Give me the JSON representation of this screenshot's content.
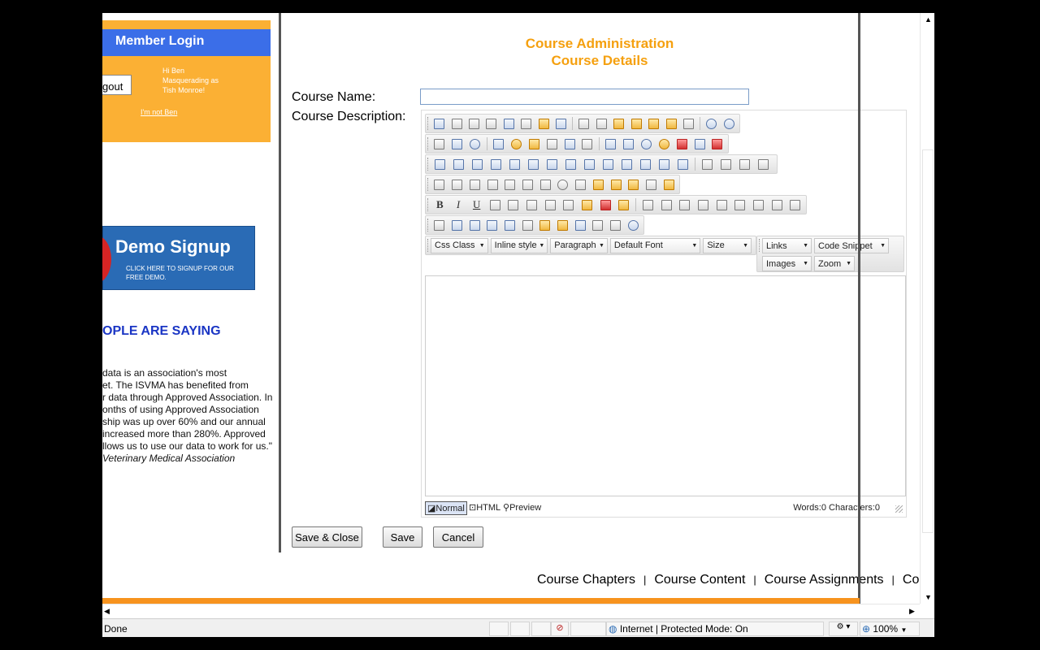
{
  "sidebar": {
    "login_title": "Member Login",
    "logout_label": "gout",
    "greeting": "Hi Ben",
    "masquerade_line1": "Masquerading as",
    "masquerade_line2": "Tish Monroe!",
    "not_ben_link": "I'm not Ben",
    "demo_title": "Demo Signup",
    "demo_subtitle_line1": "CLICK HERE TO SIGNUP FOR OUR",
    "demo_subtitle_line2": "FREE DEMO.",
    "saying_title": "OPLE ARE SAYING",
    "quote_lines": [
      "data is an association's most",
      "et. The ISVMA has benefited from",
      "r data through Approved Association. In",
      "onths of using Approved Association",
      "ship was up over 60% and our annual",
      "increased more than 280%. Approved",
      "llows us to use our data to work for us.\""
    ],
    "quote_source": "Veterinary Medical Association"
  },
  "page": {
    "title": "Course Administration",
    "subtitle": "Course Details",
    "course_name_label": "Course Name:",
    "course_name_value": "",
    "course_desc_label": "Course Description:"
  },
  "editor": {
    "dropdowns_row1": [
      "Css Class",
      "Inline style",
      "Paragraph",
      "Default Font",
      "Size"
    ],
    "dropdowns_right_row1": [
      "Links",
      "Code Snippet"
    ],
    "dropdowns_right_row2": [
      "Images",
      "Zoom"
    ],
    "mode_normal": "Normal",
    "mode_html": "HTML",
    "mode_preview": "Preview",
    "word_count": "Words:0 Characters:0"
  },
  "buttons": {
    "save_close": "Save & Close",
    "save": "Save",
    "cancel": "Cancel"
  },
  "footer_links": [
    "Course Chapters",
    "Course Content",
    "Course Assignments",
    "Course Tests"
  ],
  "statusbar": {
    "status_text": "Done",
    "zone_text": "Internet | Protected Mode: On",
    "zoom_text": "100%"
  }
}
